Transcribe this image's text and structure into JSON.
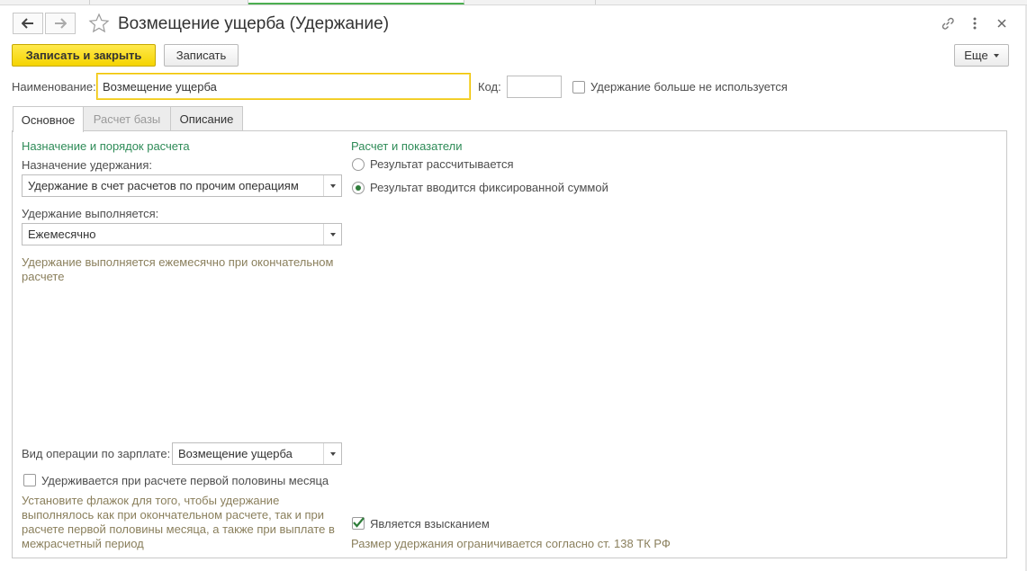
{
  "window": {
    "title": "Возмещение ущерба (Удержание)"
  },
  "icons": {
    "back": "arrow-left-icon",
    "forward": "arrow-right-icon",
    "favorite": "star-icon",
    "link": "link-icon",
    "more": "vertical-dots-icon",
    "close": "close-icon"
  },
  "toolbar": {
    "save_close_label": "Записать и закрыть",
    "save_label": "Записать",
    "more_label": "Еще"
  },
  "form": {
    "name_label": "Наименование:",
    "name_value": "Возмещение ущерба",
    "code_label": "Код:",
    "code_value": "",
    "not_used_label": "Удержание больше не используется"
  },
  "tabs": [
    {
      "label": "Основное"
    },
    {
      "label": "Расчет базы"
    },
    {
      "label": "Описание"
    }
  ],
  "left": {
    "section_title": "Назначение и порядок расчета",
    "purpose_label": "Назначение удержания:",
    "purpose_value": "Удержание в счет расчетов по прочим операциям",
    "frequency_label": "Удержание выполняется:",
    "frequency_value": "Ежемесячно",
    "frequency_hint": "Удержание выполняется ежемесячно при окончательном расчете",
    "operation_label": "Вид операции по зарплате:",
    "operation_value": "Возмещение ущерба",
    "first_half_label": "Удерживается при расчете первой половины месяца",
    "first_half_hint": "Установите флажок для того, чтобы удержание выполнялось как при окончательном расчете, так и при расчете первой половины месяца, а также при выплате в межрасчетный период"
  },
  "right": {
    "section_title": "Расчет и показатели",
    "radio_calculated": "Результат рассчитывается",
    "radio_fixed": "Результат вводится фиксированной суммой",
    "penalty_label": "Является взысканием",
    "penalty_hint": "Размер удержания ограничивается согласно ст. 138 ТК РФ"
  },
  "colors": {
    "primary_button": "#f5d400",
    "section_title": "#2e8b57",
    "hint_text": "#8a7f5c",
    "check_mark": "#2f7d3a"
  }
}
